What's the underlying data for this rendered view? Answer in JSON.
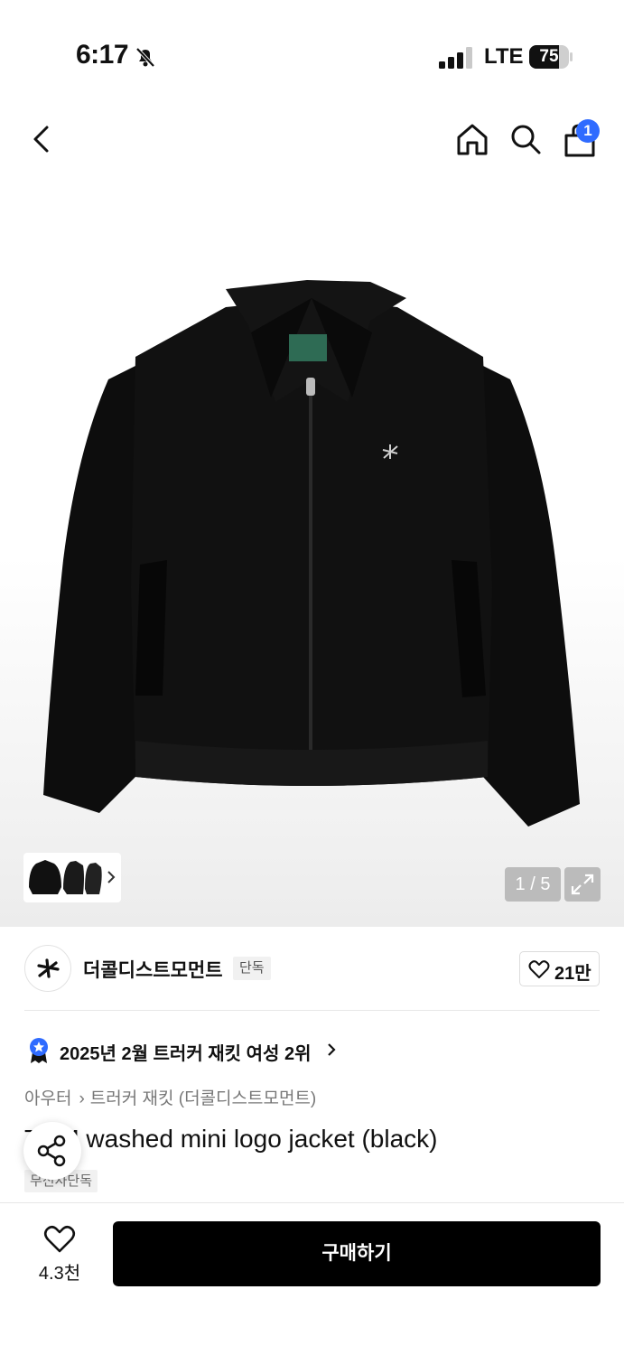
{
  "status_bar": {
    "time": "6:17",
    "network": "LTE",
    "battery_level": "75",
    "battery_fraction": 0.75
  },
  "nav": {
    "cart_count": "1",
    "icons": [
      "back-icon",
      "home-icon",
      "search-icon",
      "cart-icon"
    ]
  },
  "gallery": {
    "current": "1",
    "separator": "/",
    "total": "5"
  },
  "brand": {
    "name": "더콜디스트모먼트",
    "tag": "단독",
    "likes": "21만"
  },
  "ranking": {
    "text": "2025년 2월 트러커 재킷 여성 2위"
  },
  "breadcrumb": {
    "category": "아우터",
    "subcategory": "트러커 재킷 (더콜디스트모먼트)"
  },
  "product": {
    "title": "TCM washed mini logo jacket (black)",
    "exclusive_tag": "무신사단독"
  },
  "bottom_bar": {
    "like_count": "4.3천",
    "buy_label": "구매하기"
  },
  "colors": {
    "accent": "#2f6bff",
    "buy_button": "#000000"
  }
}
